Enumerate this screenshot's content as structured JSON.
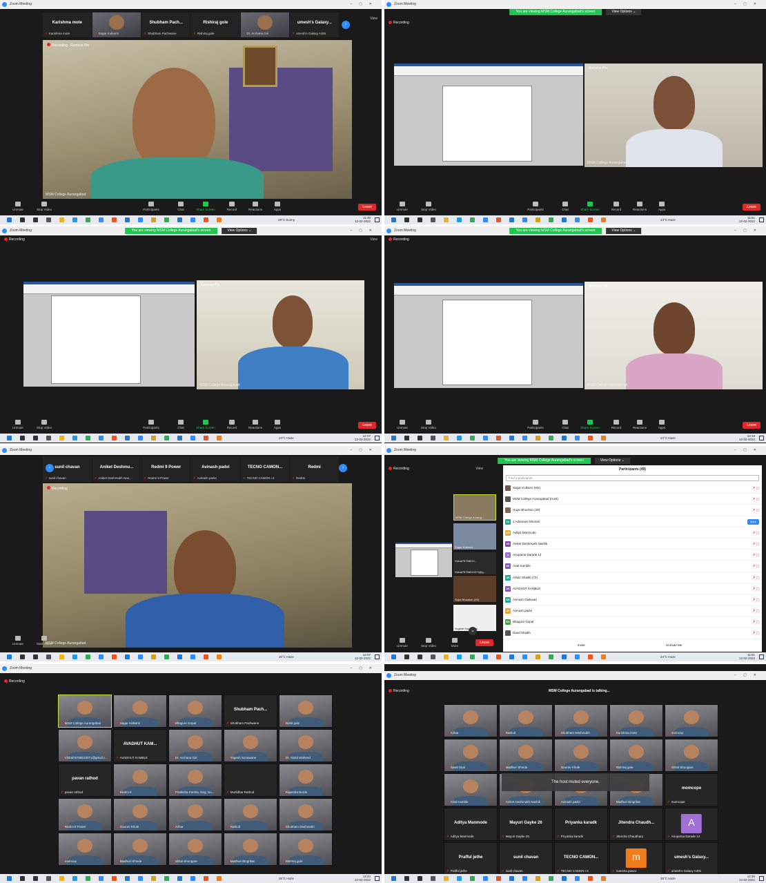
{
  "app_title": "Zoom Meeting",
  "recording_label": "Recording",
  "remove_pin_label": "Remove Pin",
  "view_label": "View",
  "share_banner": {
    "text": "You are viewing MSM College Aurangabad's screen",
    "view_options": "View Options ⌄"
  },
  "host_video_label": "MSM College Aurangabad",
  "controls": {
    "unmute": "Unmute",
    "stop_video": "Stop Video",
    "start_video": "Start Video",
    "participants": "Participants",
    "participants_count": "40",
    "chat": "Chat",
    "share_screen": "Share Screen",
    "record": "Record",
    "reactions": "Reactions",
    "apps": "Apps",
    "more": "More",
    "leave": "Leave"
  },
  "colors": {
    "zoom_blue": "#2d8cff",
    "share_green": "#23c552",
    "leave_red": "#e02828",
    "dark_bg": "#1a1a1a"
  },
  "panel1": {
    "strip": [
      {
        "name": "Karishma mote",
        "label": "Karishma mote",
        "video": false
      },
      {
        "name": "",
        "label": "Sagar Kulkarni",
        "video": true
      },
      {
        "name": "Shubham Pach...",
        "label": "Shubham Pachwane",
        "video": false
      },
      {
        "name": "Rishiraj gole",
        "label": "Rishiraj gole",
        "video": false
      },
      {
        "name": "",
        "label": "Dr. Archana Giri",
        "video": true
      },
      {
        "name": "umesh's Galaxy...",
        "label": "umesh's Galaxy A30s",
        "video": false
      }
    ],
    "weather": "29°C Sunny",
    "time": "11:30",
    "date": "12-02-2022"
  },
  "panel2": {
    "weather": "24°C Haze",
    "time": "11:51",
    "date": "12-02-2022"
  },
  "panel3": {
    "weather": "24°C Haze",
    "time": "12:07",
    "date": "12-02-2022"
  },
  "panel4": {
    "weather": "24°C Haze",
    "time": "12:19",
    "date": "12-02-2022"
  },
  "panel5": {
    "strip": [
      {
        "name": "sunil chavan",
        "label": "sunil chavan"
      },
      {
        "name": "Aniket Deshmu...",
        "label": "Aniket Deshmukh Nas..."
      },
      {
        "name": "Redmi 9 Power",
        "label": "Redmi 9 Power"
      },
      {
        "name": "Avinash padvi",
        "label": "Avinash padvi"
      },
      {
        "name": "TECNO CAMON...",
        "label": "TECNO CAMON i-4"
      },
      {
        "name": "Redmi",
        "label": "Redmi"
      }
    ],
    "weather": "26°C Haze",
    "time": "12:07",
    "date": "12-02-2022"
  },
  "panel6": {
    "participants_title": "Participants (49)",
    "find_placeholder": "Find a participant",
    "more_label": "More",
    "invite": "Invite",
    "unmute_me": "Unmute Me",
    "side_tiles": [
      {
        "label": "MSM College Aurang..."
      },
      {
        "label": "Sagar Kulkarni"
      },
      {
        "label": "Vishal78758010..."
      },
      {
        "label": "Vishal78758010071@g..."
      },
      {
        "label": "Gujar Bhushan (29)"
      },
      {
        "label": "Yogesh Sonawane"
      }
    ],
    "participants": [
      {
        "initials": "",
        "name": "Sagar Kulkarni (Me)",
        "color": "#6b5a4a"
      },
      {
        "initials": "",
        "name": "MSM College Aurangabad (Host)",
        "color": "#555555"
      },
      {
        "initials": "",
        "name": "Gujar Bhushan (29)",
        "color": "#7a6a55"
      },
      {
        "initials": "1A",
        "name": "1 Adamane Mrunali",
        "color": "#26a69a",
        "more": true
      },
      {
        "initials": "AM",
        "name": "Aditya Manmode",
        "color": "#f0a030"
      },
      {
        "initials": "AD",
        "name": "Aniket Deshmukh Nashik",
        "color": "#8e44ad"
      },
      {
        "initials": "A",
        "name": "Anupama Darade 14",
        "color": "#a16fd6"
      },
      {
        "initials": "AK",
        "name": "Arati Kamble",
        "color": "#7e57c2"
      },
      {
        "initials": "AS",
        "name": "Arbaz Shaikh (72)",
        "color": "#26a69a"
      },
      {
        "initials": "AK",
        "name": "AVADHUT KAMBLE",
        "color": "#7e57c2"
      },
      {
        "initials": "AG",
        "name": "Avinash Gaikwad",
        "color": "#26a69a"
      },
      {
        "initials": "AP",
        "name": "Avinash padvi",
        "color": "#f0a030"
      },
      {
        "initials": "BG",
        "name": "Bhagure Gopal",
        "color": "#43a047"
      },
      {
        "initials": "",
        "name": "Daud Shaikh",
        "color": "#555555"
      }
    ],
    "weather": "24°C Haze",
    "time": "11:51",
    "date": "12-02-2022"
  },
  "panel7": {
    "tiles": [
      {
        "name": "",
        "label": "MSM College Aurangabad",
        "video": true
      },
      {
        "name": "",
        "label": "Sagar Kulkarni",
        "video": true
      },
      {
        "name": "",
        "label": "Bhagure Gopal",
        "video": true
      },
      {
        "name": "Shubham Pach...",
        "label": "Shubham Pachwane",
        "video": false
      },
      {
        "name": "",
        "label": "Rohit gole",
        "video": true
      },
      {
        "name": "",
        "label": "Vishal78758010071@gmail.c...",
        "video": true
      },
      {
        "name": "AVADHUT KAM...",
        "label": "AVADHUT KAMBLE",
        "video": false
      },
      {
        "name": "",
        "label": "Dr. Archana Giri",
        "video": true
      },
      {
        "name": "",
        "label": "Yogesh Sonawane",
        "video": true
      },
      {
        "name": "",
        "label": "Dr. Abdul Waheed",
        "video": true
      },
      {
        "name": "pavan rathod",
        "label": "pavan rathod",
        "video": false
      },
      {
        "name": "",
        "label": "Redmi 9",
        "video": true
      },
      {
        "name": "",
        "label": "Pratiksha Farsha. Reg. No...",
        "video": true
      },
      {
        "name": "",
        "label": "Murlidhar Rathod",
        "video": false
      },
      {
        "name": "",
        "label": "Rajendra Borde",
        "video": true
      },
      {
        "name": "",
        "label": "Redmi 8 Power",
        "video": true
      },
      {
        "name": "",
        "label": "Gaurav Khule",
        "video": true
      },
      {
        "name": "",
        "label": "Azhar",
        "video": true
      },
      {
        "name": "",
        "label": "Rathod",
        "video": true
      },
      {
        "name": "",
        "label": "Shubham Deshmukh",
        "video": true
      },
      {
        "name": "",
        "label": "momcop",
        "video": true
      },
      {
        "name": "",
        "label": "Madhuri Shinde",
        "video": true
      },
      {
        "name": "",
        "label": "Shital Shungare",
        "video": true
      },
      {
        "name": "",
        "label": "Madhuri Bingrikar",
        "video": true
      },
      {
        "name": "",
        "label": "Rishiraj gole",
        "video": true
      }
    ],
    "weather": "26°C Haze",
    "time": "12:44",
    "date": "12-02-2022"
  },
  "panel8": {
    "talking": "MSM College Aurangabad is talking...",
    "toast": "The host muted everyone.",
    "tiles": [
      {
        "name": "",
        "label": "Azhar",
        "video": true
      },
      {
        "name": "",
        "label": "Rathod",
        "video": true
      },
      {
        "name": "",
        "label": "Shubham Deshmukh",
        "video": true
      },
      {
        "name": "",
        "label": "Karishma mote",
        "video": true
      },
      {
        "name": "",
        "label": "momcop",
        "video": true
      },
      {
        "name": "",
        "label": "Swati Dipti",
        "video": true
      },
      {
        "name": "",
        "label": "Madhuri Shinde",
        "video": true
      },
      {
        "name": "",
        "label": "Gaurav Khule",
        "video": true
      },
      {
        "name": "",
        "label": "Rishiraj gole",
        "video": true
      },
      {
        "name": "",
        "label": "Shital Shungare",
        "video": true
      },
      {
        "name": "",
        "label": "Arati Kamble",
        "video": true
      },
      {
        "name": "",
        "label": "Aniket Deshmukh Nashik",
        "video": true
      },
      {
        "name": "",
        "label": "Avinash padvi",
        "video": true
      },
      {
        "name": "",
        "label": "Madhuri Bingrikar",
        "video": true
      },
      {
        "name": "momcope",
        "label": "momcope",
        "video": false
      },
      {
        "name": "Aditya Manmode",
        "label": "Aditya Manmode",
        "video": false
      },
      {
        "name": "Mayuri Gayke 26",
        "label": "Mayuri Gayke 26",
        "video": false
      },
      {
        "name": "Priyanka karadk",
        "label": "Priyanka karadk",
        "video": false
      },
      {
        "name": "Jitendra Chaudh...",
        "label": "Jitendra Chaudhary",
        "video": false
      },
      {
        "name": "",
        "label": "Anupama Darade 14",
        "video": false,
        "avatar": "A",
        "avatar_color": "#a16fd6"
      },
      {
        "name": "Prafful jethe",
        "label": "Prafful jethe",
        "video": false
      },
      {
        "name": "sunil chavan",
        "label": "sunil chavan",
        "video": false
      },
      {
        "name": "TECNO CAMON...",
        "label": "TECNO CAMON i-4",
        "video": false
      },
      {
        "name": "",
        "label": "mansha pawar",
        "video": false,
        "avatar": "m",
        "avatar_color": "#f07c1a"
      },
      {
        "name": "umesh's Galaxy...",
        "label": "umesh's Galaxy A30s",
        "video": false
      }
    ],
    "weather": "26°C Haze",
    "time": "12:45",
    "date": "12-02-2022"
  }
}
